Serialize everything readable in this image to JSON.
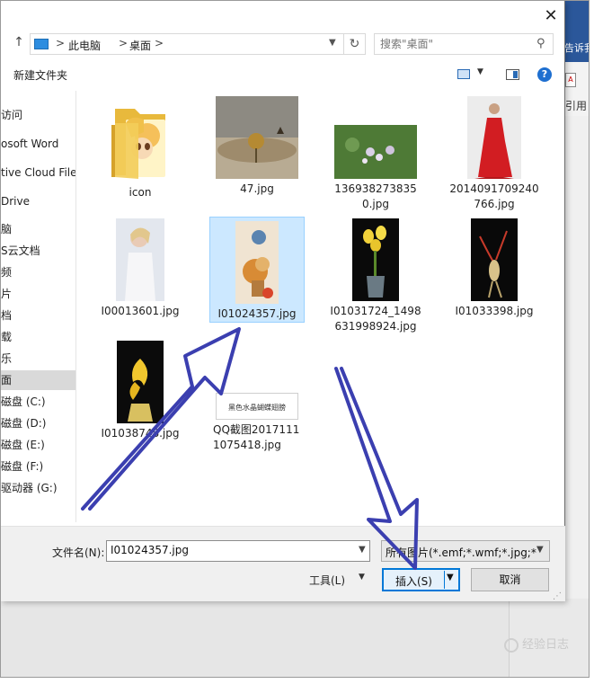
{
  "background_app": {
    "header_hint": "告诉我你想",
    "ribbon_item": "引用",
    "watermark": "经验日志"
  },
  "dialog": {
    "close_glyph": "✕",
    "address": {
      "breadcrumbs": [
        "此电脑",
        "桌面"
      ],
      "separator": ">",
      "refresh_glyph": "↻"
    },
    "search": {
      "placeholder": "搜索\"桌面\""
    },
    "toolbar": {
      "new_folder": "新建文件夹",
      "help": "?"
    },
    "sidebar": {
      "items": [
        {
          "label": "访问"
        },
        {
          "label": "osoft Word"
        },
        {
          "label": "tive Cloud Files"
        },
        {
          "label": "Drive"
        },
        {
          "label": "脑"
        },
        {
          "label": "S云文档"
        },
        {
          "label": "频"
        },
        {
          "label": "片"
        },
        {
          "label": "档"
        },
        {
          "label": "载"
        },
        {
          "label": "乐"
        },
        {
          "label": "面"
        },
        {
          "label": "磁盘 (C:)"
        },
        {
          "label": "磁盘 (D:)"
        },
        {
          "label": "磁盘 (E:)"
        },
        {
          "label": "磁盘 (F:)"
        },
        {
          "label": "驱动器 (G:)"
        }
      ],
      "selected_index": 11
    },
    "files": [
      {
        "name": "icon",
        "kind": "folder"
      },
      {
        "name": "47.jpg",
        "kind": "image"
      },
      {
        "name": "1369382738350.jpg",
        "kind": "image"
      },
      {
        "name": "2014091709240766.jpg",
        "kind": "image"
      },
      {
        "name": "I00013601.jpg",
        "kind": "image"
      },
      {
        "name": "I01024357.jpg",
        "kind": "image",
        "selected": true
      },
      {
        "name": "I01031724_1498631998924.jpg",
        "kind": "image"
      },
      {
        "name": "I01033398.jpg",
        "kind": "image"
      },
      {
        "name": "I01038748.jpg",
        "kind": "image"
      },
      {
        "name": "QQ截图20171111075418.jpg",
        "kind": "image",
        "thumb_caption": "黑色水晶蝴蝶翅膀"
      }
    ],
    "bottom": {
      "filename_label": "文件名(N):",
      "filename_value": "I01024357.jpg",
      "filetype_value": "所有图片(*.emf;*.wmf;*.jpg;*.jpeg",
      "tools_label": "工具(L)",
      "insert_label": "插入(S)",
      "cancel_label": "取消"
    }
  },
  "colors": {
    "accent": "#0078d7",
    "selection": "#cce8ff",
    "arrow": "#3b3fb0"
  }
}
